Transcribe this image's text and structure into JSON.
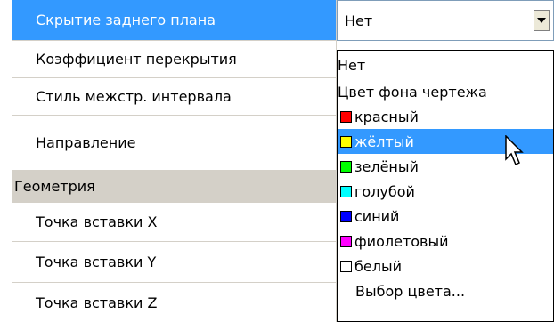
{
  "properties": [
    {
      "name": "Скрытие заднего плана",
      "type": "property",
      "selected": true
    },
    {
      "name": "Коэффициент перекрытия",
      "type": "property"
    },
    {
      "name": "Стиль межстр. интервала",
      "type": "property"
    },
    {
      "name": "Направление",
      "type": "property"
    },
    {
      "name": "Геометрия",
      "type": "category"
    },
    {
      "name": "Точка вставки X",
      "type": "property"
    },
    {
      "name": "Точка вставки Y",
      "type": "property"
    },
    {
      "name": "Точка вставки Z",
      "type": "property"
    }
  ],
  "combo": {
    "value": "Нет",
    "arrow_icon": "chevron-down-icon"
  },
  "dropdown": {
    "highlighted_index": 3,
    "options": [
      {
        "label": "Нет",
        "swatch": null
      },
      {
        "label": "Цвет фона чертежа",
        "swatch": null
      },
      {
        "label": "красный",
        "swatch": "#ff0000"
      },
      {
        "label": "жёлтый",
        "swatch": "#ffff00"
      },
      {
        "label": "зелёный",
        "swatch": "#00ff00"
      },
      {
        "label": "голубой",
        "swatch": "#00ffff"
      },
      {
        "label": "синий",
        "swatch": "#0000ff"
      },
      {
        "label": "фиолетовый",
        "swatch": "#ff00ff"
      },
      {
        "label": "белый",
        "swatch": "#ffffff"
      },
      {
        "label": "Выбор цвета...",
        "swatch": null
      }
    ]
  },
  "colors": {
    "selection": "#3399ff",
    "category_bg": "#d4d0c8",
    "grid_line": "#d4d0c8"
  }
}
